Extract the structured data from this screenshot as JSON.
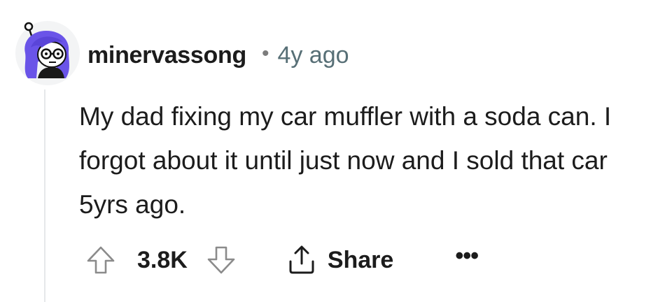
{
  "comment": {
    "author": "minervassong",
    "separator": "•",
    "timestamp": "4y ago",
    "body": "My dad fixing my car muffler with a soda can. I forgot about it until just now and I sold that car 5yrs ago."
  },
  "actions": {
    "score": "3.8K",
    "share_label": "Share",
    "more_label": "•••"
  },
  "icons": {
    "upvote": "arrow-up-icon",
    "downvote": "arrow-down-icon",
    "share": "share-icon",
    "more": "more-options-icon"
  },
  "colors": {
    "text": "#1c1c1c",
    "meta": "#576f76",
    "icon": "#8b8b8b",
    "avatar_hair": "#6a54e8",
    "thread_line": "#e5e8ea"
  }
}
